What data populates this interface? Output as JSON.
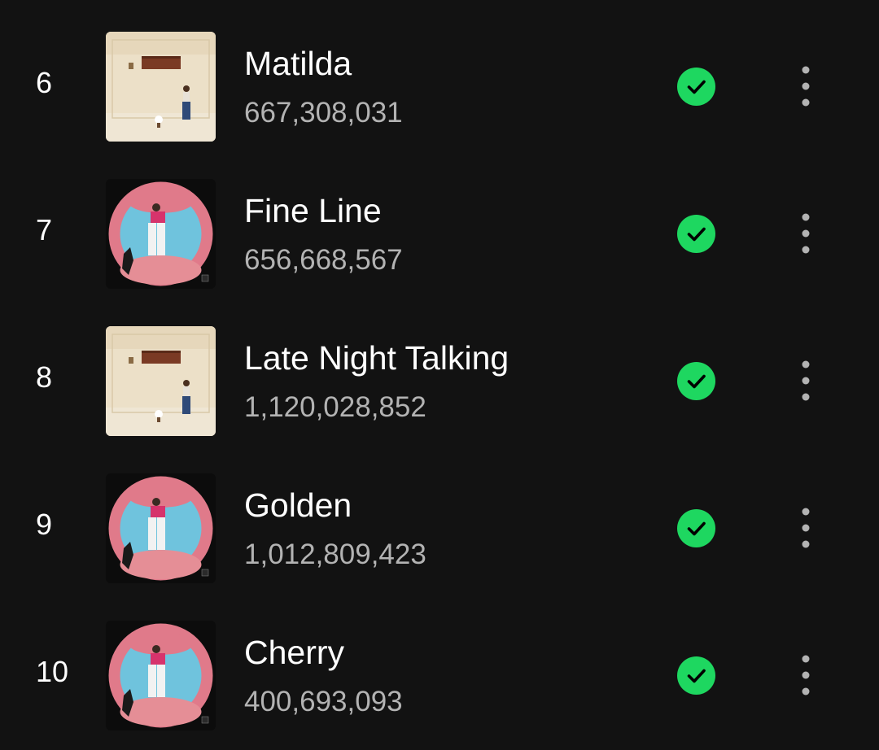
{
  "colors": {
    "background": "#121212",
    "primary_text": "#ffffff",
    "secondary_text": "#b3b3b3",
    "accent_green": "#1ed760"
  },
  "tracks": [
    {
      "rank": "6",
      "title": "Matilda",
      "plays": "667,308,031",
      "cover": "harrys-house-album-art",
      "saved_icon": "check-circle-icon",
      "menu_icon": "more-vertical-icon"
    },
    {
      "rank": "7",
      "title": "Fine Line",
      "plays": "656,668,567",
      "cover": "fine-line-album-art",
      "saved_icon": "check-circle-icon",
      "menu_icon": "more-vertical-icon"
    },
    {
      "rank": "8",
      "title": "Late Night Talking",
      "plays": "1,120,028,852",
      "cover": "harrys-house-album-art",
      "saved_icon": "check-circle-icon",
      "menu_icon": "more-vertical-icon"
    },
    {
      "rank": "9",
      "title": "Golden",
      "plays": "1,012,809,423",
      "cover": "fine-line-album-art",
      "saved_icon": "check-circle-icon",
      "menu_icon": "more-vertical-icon"
    },
    {
      "rank": "10",
      "title": "Cherry",
      "plays": "400,693,093",
      "cover": "fine-line-album-art",
      "saved_icon": "check-circle-icon",
      "menu_icon": "more-vertical-icon"
    }
  ]
}
